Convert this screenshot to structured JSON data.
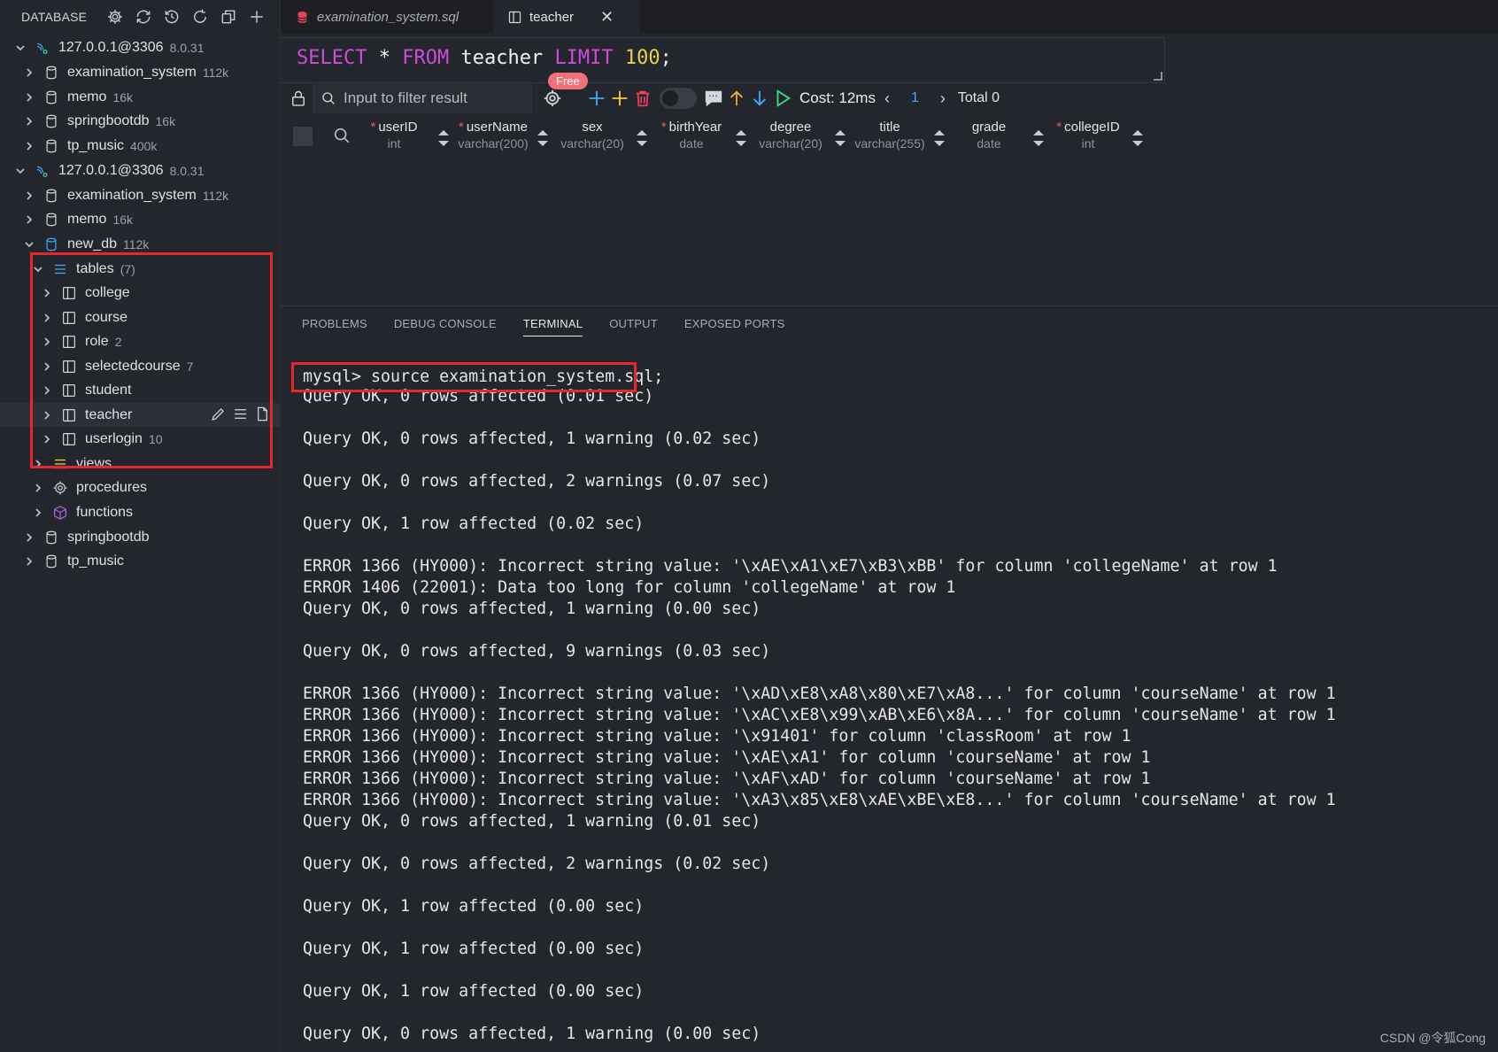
{
  "sidebar": {
    "title": "DATABASE",
    "tools": [
      "gear-icon",
      "sync-icon",
      "history-icon",
      "refresh-icon",
      "copy-icon",
      "plus-icon"
    ],
    "tree": [
      {
        "label": "127.0.0.1@3306",
        "meta": "8.0.31",
        "type": "connection",
        "expanded": true
      },
      {
        "label": "examination_system",
        "meta": "112k",
        "type": "database"
      },
      {
        "label": "memo",
        "meta": "16k",
        "type": "database"
      },
      {
        "label": "springbootdb",
        "meta": "16k",
        "type": "database"
      },
      {
        "label": "tp_music",
        "meta": "400k",
        "type": "database"
      },
      {
        "label": "127.0.0.1@3306",
        "meta": "8.0.31",
        "type": "connection",
        "expanded": true
      },
      {
        "label": "examination_system",
        "meta": "112k",
        "type": "database"
      },
      {
        "label": "memo",
        "meta": "16k",
        "type": "database"
      },
      {
        "label": "new_db",
        "meta": "112k",
        "type": "database",
        "expanded": true
      },
      {
        "label": "tables",
        "meta": "(7)",
        "type": "group",
        "expanded": true
      },
      {
        "label": "college",
        "meta": "",
        "type": "table"
      },
      {
        "label": "course",
        "meta": "",
        "type": "table"
      },
      {
        "label": "role",
        "meta": "2",
        "type": "table"
      },
      {
        "label": "selectedcourse",
        "meta": "7",
        "type": "table"
      },
      {
        "label": "student",
        "meta": "",
        "type": "table"
      },
      {
        "label": "teacher",
        "meta": "",
        "type": "table",
        "highlighted": true
      },
      {
        "label": "userlogin",
        "meta": "10",
        "type": "table"
      },
      {
        "label": "views",
        "meta": "",
        "type": "views"
      },
      {
        "label": "procedures",
        "meta": "",
        "type": "procedures"
      },
      {
        "label": "functions",
        "meta": "",
        "type": "functions"
      },
      {
        "label": "springbootdb",
        "meta": "",
        "type": "database"
      },
      {
        "label": "tp_music",
        "meta": "",
        "type": "database"
      }
    ]
  },
  "tabs": [
    {
      "label": "examination_system.sql",
      "active": false
    },
    {
      "label": "teacher",
      "active": true,
      "close": "✕"
    }
  ],
  "editor": {
    "sql": {
      "kw1": "SELECT",
      "star": " * ",
      "kw2": "FROM",
      "table": " teacher ",
      "kw3": "LIMIT",
      "num": " 100",
      "semi": ";"
    }
  },
  "toolbar": {
    "filter_placeholder": "Input to filter result",
    "badge": "Free",
    "cost": "Cost: 12ms",
    "page": "1",
    "total": "Total 0",
    "prev": "‹",
    "next": "›"
  },
  "grid": {
    "columns": [
      {
        "name": "userID",
        "type": "int",
        "required": true
      },
      {
        "name": "userName",
        "type": "varchar(200)",
        "required": true
      },
      {
        "name": "sex",
        "type": "varchar(20)",
        "required": false
      },
      {
        "name": "birthYear",
        "type": "date",
        "required": true
      },
      {
        "name": "degree",
        "type": "varchar(20)",
        "required": false
      },
      {
        "name": "title",
        "type": "varchar(255)",
        "required": false
      },
      {
        "name": "grade",
        "type": "date",
        "required": false
      },
      {
        "name": "collegeID",
        "type": "int",
        "required": true
      }
    ]
  },
  "panel": {
    "tabs": [
      "PROBLEMS",
      "DEBUG CONSOLE",
      "TERMINAL",
      "OUTPUT",
      "EXPOSED PORTS"
    ],
    "active_tab": "TERMINAL",
    "terminal_lines": [
      "mysql> source examination_system.sql;",
      "Query OK, 0 rows affected (0.01 sec)",
      "",
      "Query OK, 0 rows affected, 1 warning (0.02 sec)",
      "",
      "Query OK, 0 rows affected, 2 warnings (0.07 sec)",
      "",
      "Query OK, 1 row affected (0.02 sec)",
      "",
      "ERROR 1366 (HY000): Incorrect string value: '\\xAE\\xA1\\xE7\\xB3\\xBB' for column 'collegeName' at row 1",
      "ERROR 1406 (22001): Data too long for column 'collegeName' at row 1",
      "Query OK, 0 rows affected, 1 warning (0.00 sec)",
      "",
      "Query OK, 0 rows affected, 9 warnings (0.03 sec)",
      "",
      "ERROR 1366 (HY000): Incorrect string value: '\\xAD\\xE8\\xA8\\x80\\xE7\\xA8...' for column 'courseName' at row 1",
      "ERROR 1366 (HY000): Incorrect string value: '\\xAC\\xE8\\x99\\xAB\\xE6\\x8A...' for column 'courseName' at row 1",
      "ERROR 1366 (HY000): Incorrect string value: '\\x91401' for column 'classRoom' at row 1",
      "ERROR 1366 (HY000): Incorrect string value: '\\xAE\\xA1' for column 'courseName' at row 1",
      "ERROR 1366 (HY000): Incorrect string value: '\\xAF\\xAD' for column 'courseName' at row 1",
      "ERROR 1366 (HY000): Incorrect string value: '\\xA3\\x85\\xE8\\xAE\\xBE\\xE8...' for column 'courseName' at row 1",
      "Query OK, 0 rows affected, 1 warning (0.01 sec)",
      "",
      "Query OK, 0 rows affected, 2 warnings (0.02 sec)",
      "",
      "Query OK, 1 row affected (0.00 sec)",
      "",
      "Query OK, 1 row affected (0.00 sec)",
      "",
      "Query OK, 1 row affected (0.00 sec)",
      "",
      "Query OK, 0 rows affected, 1 warning (0.00 sec)"
    ]
  },
  "watermark": "CSDN @令狐Cong",
  "colors": {
    "accent": "#4da3ff",
    "highlight_box": "#e8262b",
    "keyword": "#d04bd8",
    "number": "#e9d24a"
  }
}
